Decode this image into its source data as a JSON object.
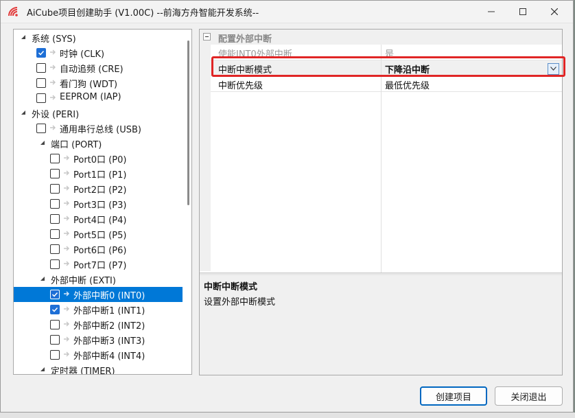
{
  "window": {
    "title": "AiCube项目创建助手 (V1.00C) --前海方舟智能开发系统--",
    "app_icon": "aicube-logo-icon",
    "controls": [
      "minimize-icon",
      "maximize-icon",
      "close-icon"
    ]
  },
  "tree": {
    "items": [
      {
        "label": "系统 (SYS)",
        "level": 0,
        "expanded": true
      },
      {
        "label": "时钟 (CLK)",
        "level": 1,
        "checkbox": true,
        "checked": true
      },
      {
        "label": "自动追频 (CRE)",
        "level": 1,
        "checkbox": true,
        "checked": false
      },
      {
        "label": "看门狗 (WDT)",
        "level": 1,
        "checkbox": true,
        "checked": false
      },
      {
        "label": "EEPROM (IAP)",
        "level": 1,
        "checkbox": true,
        "checked": false
      },
      {
        "label": "外设 (PERI)",
        "level": 0,
        "expanded": true
      },
      {
        "label": "通用串行总线 (USB)",
        "level": 1,
        "checkbox": true,
        "checked": false
      },
      {
        "label": "端口 (PORT)",
        "level": 1,
        "expanded": true
      },
      {
        "label": "Port0口 (P0)",
        "level": 2,
        "checkbox": true,
        "checked": false
      },
      {
        "label": "Port1口 (P1)",
        "level": 2,
        "checkbox": true,
        "checked": false
      },
      {
        "label": "Port2口 (P2)",
        "level": 2,
        "checkbox": true,
        "checked": false
      },
      {
        "label": "Port3口 (P3)",
        "level": 2,
        "checkbox": true,
        "checked": false
      },
      {
        "label": "Port4口 (P4)",
        "level": 2,
        "checkbox": true,
        "checked": false
      },
      {
        "label": "Port5口 (P5)",
        "level": 2,
        "checkbox": true,
        "checked": false
      },
      {
        "label": "Port6口 (P6)",
        "level": 2,
        "checkbox": true,
        "checked": false
      },
      {
        "label": "Port7口 (P7)",
        "level": 2,
        "checkbox": true,
        "checked": false
      },
      {
        "label": "外部中断 (EXTI)",
        "level": 1,
        "expanded": true
      },
      {
        "label": "外部中断0 (INT0)",
        "level": 2,
        "checkbox": true,
        "checked": true,
        "selected": true
      },
      {
        "label": "外部中断1 (INT1)",
        "level": 2,
        "checkbox": true,
        "checked": true
      },
      {
        "label": "外部中断2 (INT2)",
        "level": 2,
        "checkbox": true,
        "checked": false
      },
      {
        "label": "外部中断3 (INT3)",
        "level": 2,
        "checkbox": true,
        "checked": false
      },
      {
        "label": "外部中断4 (INT4)",
        "level": 2,
        "checkbox": true,
        "checked": false
      },
      {
        "label": "定时器 (TIMER)",
        "level": 1,
        "expanded": true
      }
    ]
  },
  "properties": {
    "category": "配置外部中断",
    "rows": [
      {
        "name": "使能INT0外部中断",
        "value": "是",
        "disabled": true
      },
      {
        "name": "中断中断模式",
        "value": "下降沿中断",
        "selected": true,
        "dropdown": true
      },
      {
        "name": "中断优先级",
        "value": "最低优先级"
      }
    ],
    "description": {
      "title": "中断中断模式",
      "text": "设置外部中断模式"
    }
  },
  "buttons": {
    "create": "创建项目",
    "close": "关闭退出"
  },
  "colors": {
    "selection": "#0078d7",
    "checkbox_checked": "#1e6fd6",
    "highlight_box": "#e02525",
    "primary_button_border": "#0067c0"
  }
}
